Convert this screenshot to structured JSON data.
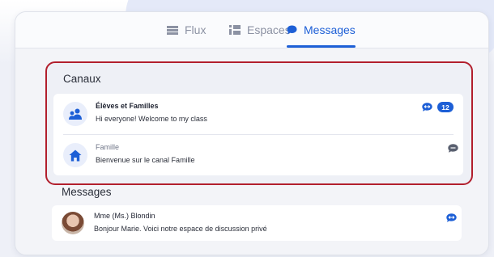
{
  "tabs": [
    {
      "label": "Flux",
      "icon": "feed-icon"
    },
    {
      "label": "Espaces",
      "icon": "spaces-icon"
    },
    {
      "label": "Messages",
      "icon": "message-bubble-icon",
      "active": true
    }
  ],
  "canaux": {
    "title": "Canaux",
    "items": [
      {
        "name": "Élèves et Familles",
        "preview": "Hi everyone! Welcome to my class",
        "icon": "group-icon",
        "unread_count": "12"
      },
      {
        "name": "Famille",
        "preview": "Bienvenue sur le canal Famille",
        "icon": "house-icon"
      }
    ]
  },
  "messages": {
    "title": "Messages",
    "items": [
      {
        "name": "Mme (Ms.) Blondin",
        "preview": "Bonjour Marie. Voici notre espace de discussion privé",
        "icon": "user-avatar"
      }
    ]
  },
  "colors": {
    "accent": "#1d5fd6",
    "highlight_border": "#b21f2d",
    "muted": "#8c92a3"
  }
}
